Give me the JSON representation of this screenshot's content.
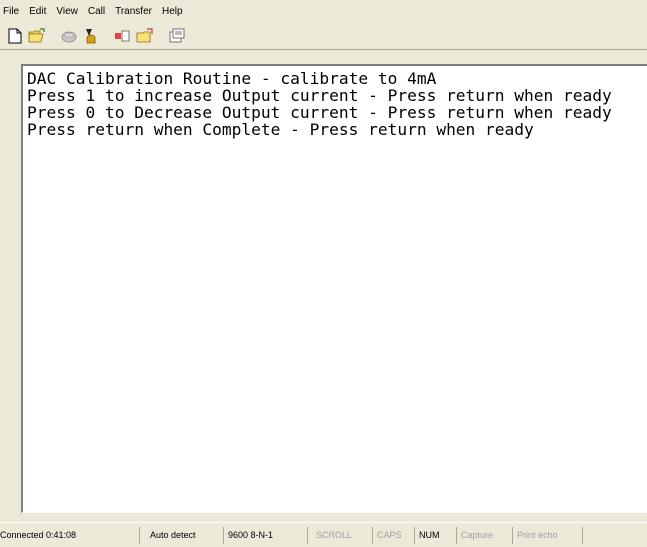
{
  "menu": [
    "File",
    "Edit",
    "View",
    "Call",
    "Transfer",
    "Help"
  ],
  "terminal": {
    "lines": [
      "DAC Calibration Routine - calibrate to 4mA",
      "Press 1 to increase Output current - Press return when ready",
      "Press 0 to Decrease Output current - Press return when ready",
      "Press return when Complete - Press return when ready"
    ]
  },
  "status": {
    "connected": "Connected 0:41:08",
    "detect": "Auto detect",
    "settings": "9600 8-N-1",
    "scroll": "SCROLL",
    "caps": "CAPS",
    "num": "NUM",
    "capture": "Capture",
    "print_echo": "Print echo"
  }
}
